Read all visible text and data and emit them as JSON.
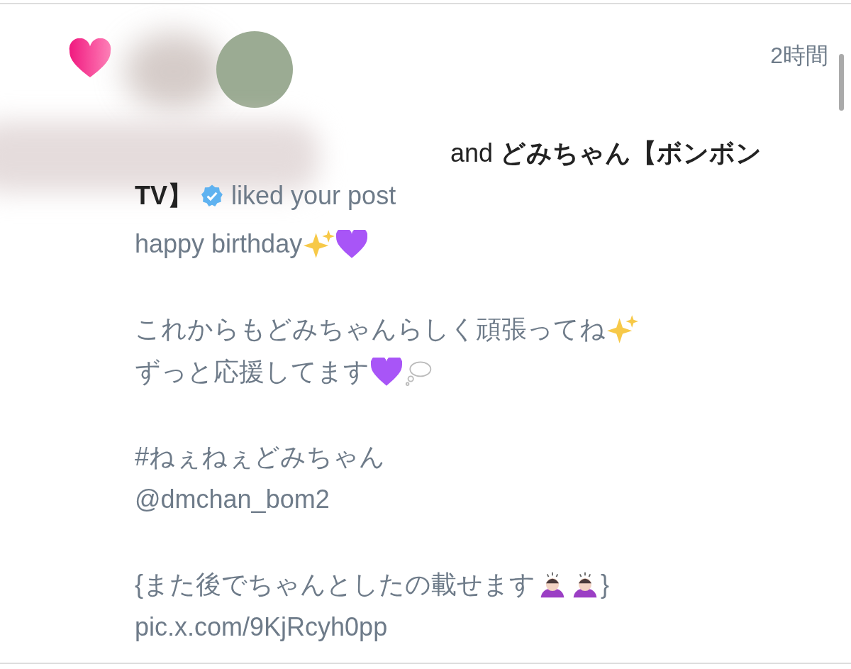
{
  "notification": {
    "time": "2時間",
    "actors_lines": [
      "and **どみちゃん【ボンボン**",
      "**TV】**"
    ],
    "verified": true,
    "action": "liked your post",
    "post": [
      [
        [
          {
            "text": "happy birthday"
          },
          {
            "kind": "sparkles"
          },
          {
            "kind": "heart"
          }
        ]
      ],
      [
        [
          {
            "text": "これからもどみちゃんらしく頑張ってね"
          },
          {
            "kind": "sparkles"
          }
        ],
        [
          {
            "text": "ずっと応援してます"
          },
          {
            "kind": "heart"
          },
          {
            "kind": "bubble"
          }
        ]
      ],
      [
        [
          {
            "text": "#ねぇねぇどみちゃん"
          }
        ],
        [
          {
            "text": "@dmchan_bom2"
          }
        ]
      ],
      [
        [
          {
            "text": "{また後でちゃんとしたの載せます"
          },
          {
            "kind": "bow"
          },
          {
            "kind": "bow"
          },
          {
            "text": "}"
          }
        ],
        [
          {
            "text": "pic.x.com/9KjRcyh0pp"
          }
        ]
      ]
    ]
  }
}
